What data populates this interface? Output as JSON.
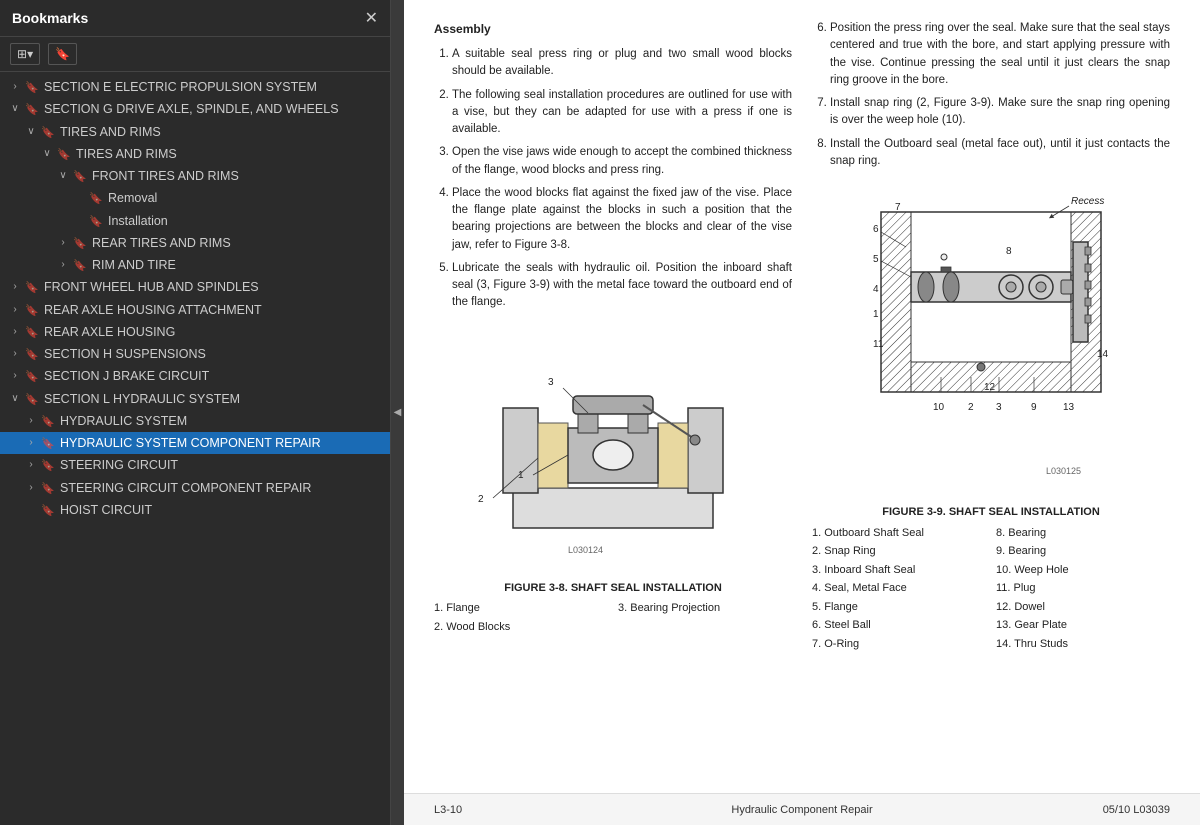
{
  "sidebar": {
    "title": "Bookmarks",
    "close_label": "✕",
    "toolbar": {
      "view_btn": "⊞▾",
      "bookmark_btn": "🔖"
    },
    "items": [
      {
        "id": "section-e",
        "label": "SECTION E ELECTRIC PROPULSION SYSTEM",
        "level": 0,
        "expanded": false,
        "selected": false,
        "expander": "›"
      },
      {
        "id": "section-g",
        "label": "SECTION G DRIVE AXLE, SPINDLE, AND WHEELS",
        "level": 0,
        "expanded": true,
        "selected": false,
        "expander": "∨"
      },
      {
        "id": "tires-rims-parent",
        "label": "TIRES AND RIMS",
        "level": 1,
        "expanded": true,
        "selected": false,
        "expander": "∨"
      },
      {
        "id": "tires-rims-sub",
        "label": "TIRES AND RIMS",
        "level": 2,
        "expanded": true,
        "selected": false,
        "expander": "∨"
      },
      {
        "id": "front-tires",
        "label": "FRONT TIRES AND RIMS",
        "level": 3,
        "expanded": true,
        "selected": false,
        "expander": "∨"
      },
      {
        "id": "removal",
        "label": "Removal",
        "level": 4,
        "expanded": false,
        "selected": false,
        "expander": ""
      },
      {
        "id": "installation",
        "label": "Installation",
        "level": 4,
        "expanded": false,
        "selected": false,
        "expander": ""
      },
      {
        "id": "rear-tires",
        "label": "REAR TIRES AND RIMS",
        "level": 3,
        "expanded": false,
        "selected": false,
        "expander": "›"
      },
      {
        "id": "rim-and-tire",
        "label": "RIM AND TIRE",
        "level": 3,
        "expanded": false,
        "selected": false,
        "expander": "›"
      },
      {
        "id": "front-wheel",
        "label": "FRONT WHEEL HUB AND SPINDLES",
        "level": 0,
        "expanded": false,
        "selected": false,
        "expander": "›"
      },
      {
        "id": "rear-axle-attach",
        "label": "REAR AXLE HOUSING ATTACHMENT",
        "level": 0,
        "expanded": false,
        "selected": false,
        "expander": "›"
      },
      {
        "id": "rear-axle-housing",
        "label": "REAR AXLE HOUSING",
        "level": 0,
        "expanded": false,
        "selected": false,
        "expander": "›"
      },
      {
        "id": "section-h",
        "label": "SECTION H SUSPENSIONS",
        "level": 0,
        "expanded": false,
        "selected": false,
        "expander": "›"
      },
      {
        "id": "section-j",
        "label": "SECTION J BRAKE CIRCUIT",
        "level": 0,
        "expanded": false,
        "selected": false,
        "expander": "›"
      },
      {
        "id": "section-l",
        "label": "SECTION L  HYDRAULIC SYSTEM",
        "level": 0,
        "expanded": true,
        "selected": false,
        "expander": "∨"
      },
      {
        "id": "hydraulic-system",
        "label": "HYDRAULIC SYSTEM",
        "level": 1,
        "expanded": false,
        "selected": false,
        "expander": "›"
      },
      {
        "id": "hydraulic-repair",
        "label": "HYDRAULIC SYSTEM COMPONENT REPAIR",
        "level": 1,
        "expanded": false,
        "selected": true,
        "expander": "›"
      },
      {
        "id": "steering-circuit",
        "label": "STEERING CIRCUIT",
        "level": 1,
        "expanded": false,
        "selected": false,
        "expander": "›"
      },
      {
        "id": "steering-repair",
        "label": "STEERING CIRCUIT COMPONENT REPAIR",
        "level": 1,
        "expanded": false,
        "selected": false,
        "expander": "›"
      },
      {
        "id": "hoist-circuit",
        "label": "HOIST CIRCUIT",
        "level": 1,
        "expanded": false,
        "selected": false,
        "expander": ""
      }
    ]
  },
  "content": {
    "assembly": {
      "title": "Assembly",
      "steps": [
        "A suitable seal press ring or plug and two small wood blocks should be available.",
        "The following seal installation procedures are outlined for use with a vise, but they can be adapted for use with a press if one is available.",
        "Open the vise jaws wide enough to accept the combined thickness of the flange, wood blocks and press ring.",
        "Place the wood blocks flat against the fixed jaw of the vise. Place the flange plate against the blocks in such a position that the bearing projections are between the blocks and clear of the vise jaw, refer to Figure 3-8.",
        "Lubricate the seals with hydraulic oil. Position the inboard shaft seal (3, Figure 3-9) with the metal face toward the outboard end of the flange.",
        "Position the press ring over the seal. Make sure that the seal stays centered and true with the bore, and start applying pressure with the vise. Continue pressing the seal until it just clears the snap ring groove in the bore.",
        "Install snap ring (2, Figure 3-9). Make sure the snap ring opening is over the weep hole (10).",
        "Install the Outboard seal (metal face out), until it just contacts the snap ring."
      ]
    },
    "figure_3_8": {
      "label": "FIGURE 3-8. SHAFT SEAL INSTALLATION",
      "legend": [
        {
          "num": "1.",
          "text": "Flange"
        },
        {
          "num": "3.",
          "text": "Bearing Projection"
        },
        {
          "num": "2.",
          "text": "Wood Blocks"
        }
      ],
      "ref": "L030124"
    },
    "figure_3_9": {
      "label": "FIGURE 3-9. SHAFT SEAL INSTALLATION",
      "recess_label": "Recess",
      "legend": [
        {
          "num": "1.",
          "text": "Outboard Shaft Seal"
        },
        {
          "num": "8.",
          "text": "Bearing"
        },
        {
          "num": "2.",
          "text": "Snap Ring"
        },
        {
          "num": "9.",
          "text": "Bearing"
        },
        {
          "num": "3.",
          "text": "Inboard Shaft Seal"
        },
        {
          "num": "10.",
          "text": "Weep Hole"
        },
        {
          "num": "4.",
          "text": "Seal, Metal Face"
        },
        {
          "num": "11.",
          "text": "Plug"
        },
        {
          "num": "5.",
          "text": "Flange"
        },
        {
          "num": "12.",
          "text": "Dowel"
        },
        {
          "num": "6.",
          "text": "Steel Ball"
        },
        {
          "num": "13.",
          "text": "Gear Plate"
        },
        {
          "num": "7.",
          "text": "O-Ring"
        },
        {
          "num": "14.",
          "text": "Thru Studs"
        }
      ],
      "ref": "L030125"
    },
    "footer": {
      "left": "L3-10",
      "center": "Hydraulic Component Repair",
      "right": "05/10  L03039"
    }
  }
}
